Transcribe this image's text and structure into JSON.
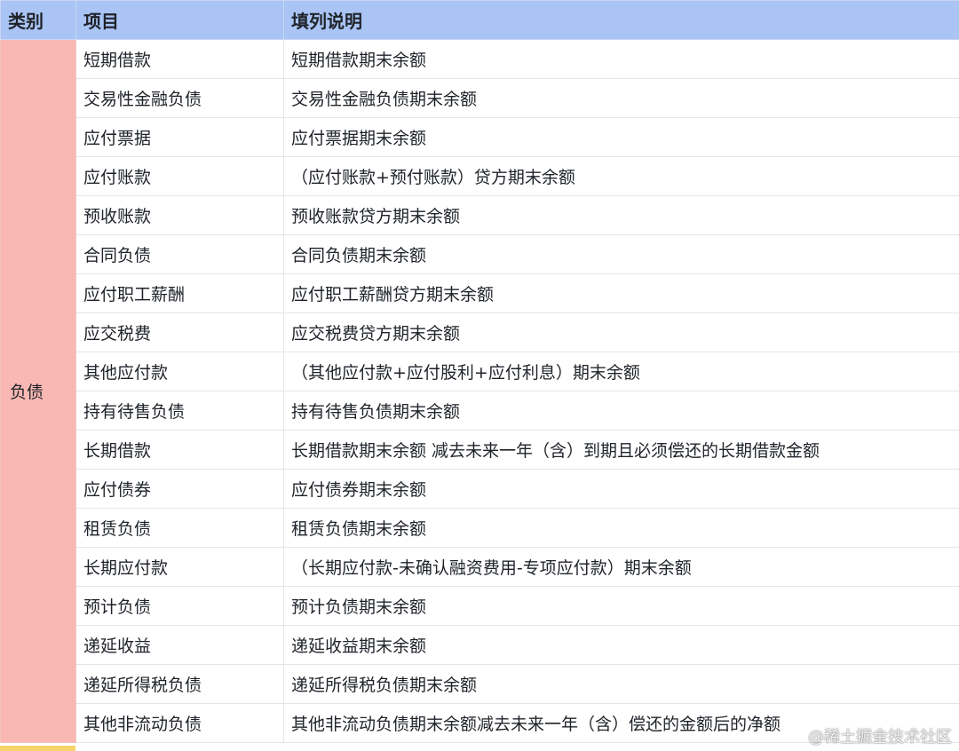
{
  "header": {
    "category": "类别",
    "item": "项目",
    "description": "填列说明"
  },
  "category_label": "负债",
  "rows": [
    {
      "item": "短期借款",
      "description": "短期借款期末余额"
    },
    {
      "item": "交易性金融负债",
      "description": "交易性金融负债期末余额"
    },
    {
      "item": "应付票据",
      "description": "应付票据期末余额"
    },
    {
      "item": "应付账款",
      "description": "（应付账款+预付账款）贷方期末余额"
    },
    {
      "item": "预收账款",
      "description": "预收账款贷方期末余额"
    },
    {
      "item": "合同负债",
      "description": "合同负债期末余额"
    },
    {
      "item": "应付职工薪酬",
      "description": "应付职工薪酬贷方期末余额"
    },
    {
      "item": "应交税费",
      "description": "应交税费贷方期末余额"
    },
    {
      "item": "其他应付款",
      "description": "（其他应付款+应付股利+应付利息）期末余额"
    },
    {
      "item": "持有待售负债",
      "description": "持有待售负债期末余额"
    },
    {
      "item": "长期借款",
      "description": "长期借款期末余额 减去未来一年（含）到期且必须偿还的长期借款金额"
    },
    {
      "item": "应付债券",
      "description": "应付债券期末余额"
    },
    {
      "item": "租赁负债",
      "description": "租赁负债期末余额"
    },
    {
      "item": "长期应付款",
      "description": "（长期应付款-未确认融资费用-专项应付款）期末余额"
    },
    {
      "item": "预计负债",
      "description": "预计负债期末余额"
    },
    {
      "item": "递延收益",
      "description": "递延收益期末余额"
    },
    {
      "item": "递延所得税负债",
      "description": "递延所得税负债期末余额"
    },
    {
      "item": "其他非流动负债",
      "description": "其他非流动负债期末余额减去未来一年（含）偿还的金额后的净额"
    }
  ],
  "watermark": "@稀土掘金技术社区",
  "colors": {
    "header_bg": "#a9c4f5",
    "category_bg": "#f9b8b3",
    "bottom_strip": "#f5d46a"
  }
}
